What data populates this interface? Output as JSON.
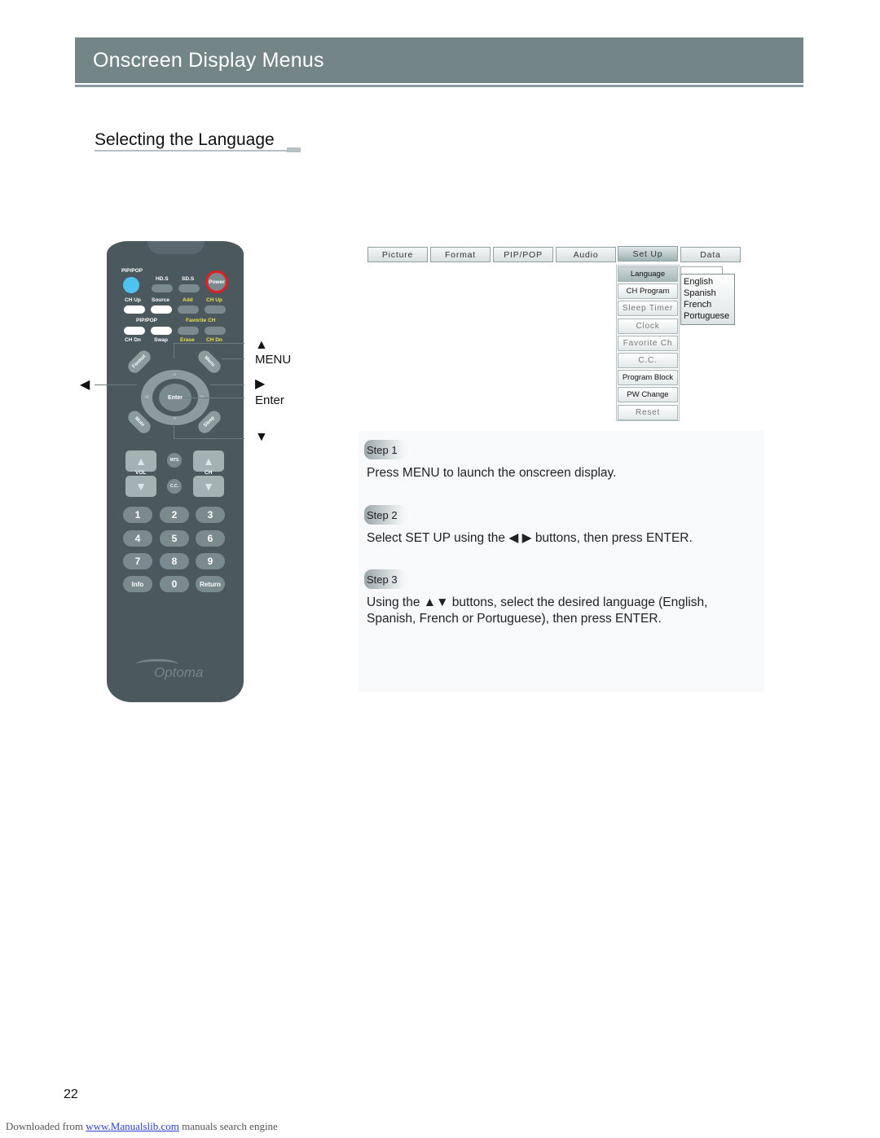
{
  "header": {
    "title": "Onscreen Display Menus"
  },
  "section": {
    "title": "Selecting the Language"
  },
  "remote": {
    "brand": "Optoma",
    "row1_labels": [
      "PIP/POP",
      "HD.S",
      "SD.S"
    ],
    "power_label": "Power",
    "row2_labels": [
      "CH Up",
      "Source",
      "Add",
      "CH Up"
    ],
    "row3_labels": [
      "PIP/POP",
      "Favorite CH"
    ],
    "row4_labels": [
      "CH Dn",
      "Swap",
      "Erase",
      "CH Dn"
    ],
    "dpad": {
      "enter": "Enter",
      "up": "▲",
      "down": "▼",
      "left": "◀",
      "right": "▶"
    },
    "corner_buttons": [
      "Format",
      "Menu",
      "Mute",
      "Sleep"
    ],
    "vol_label": "VOL",
    "ch_label": "CH",
    "mts_label": "MTS",
    "cc_label": "C.C.",
    "number_keys": [
      "1",
      "2",
      "3",
      "4",
      "5",
      "6",
      "7",
      "8",
      "9",
      "Info",
      "0",
      "Return"
    ],
    "colors": {
      "body": "#4b585e",
      "pip_button": "#4fc3f0",
      "power_ring": "#e02020",
      "yellow_label": "#e8e04a"
    }
  },
  "callouts": {
    "up_icon": "▲",
    "menu": "MENU",
    "left_icon": "◀",
    "right_icon": "▶",
    "enter": "Enter",
    "down_icon": "▼"
  },
  "osd": {
    "tabs": [
      "Picture",
      "Format",
      "PIP/POP",
      "Audio",
      "Set Up",
      "Data"
    ],
    "active_tab": "Set Up",
    "setup_items": [
      "Language",
      "CH Program",
      "Sleep Timer",
      "Clock",
      "Favorite Ch",
      "C.C.",
      "Program Block",
      "PW Change",
      "Reset"
    ],
    "active_item": "Language",
    "languages": [
      "English",
      "Spanish",
      "French",
      "Portuguese"
    ]
  },
  "steps": [
    {
      "label": "Step 1",
      "text": "Press MENU to launch the onscreen display."
    },
    {
      "label": "Step 2",
      "text_before": "Select SET UP using the",
      "icons": "◀ ▶",
      "text_after": "buttons, then press ENTER."
    },
    {
      "label": "Step 3",
      "text_before": "Using the",
      "icons": "▲▼",
      "text_after": "buttons, select the desired language (English, Spanish, French or Portuguese), then press ENTER."
    }
  ],
  "page_number": "22",
  "footer": {
    "prefix": "Downloaded from",
    "link": "www.Manualslib.com",
    "suffix": "manuals search engine"
  }
}
